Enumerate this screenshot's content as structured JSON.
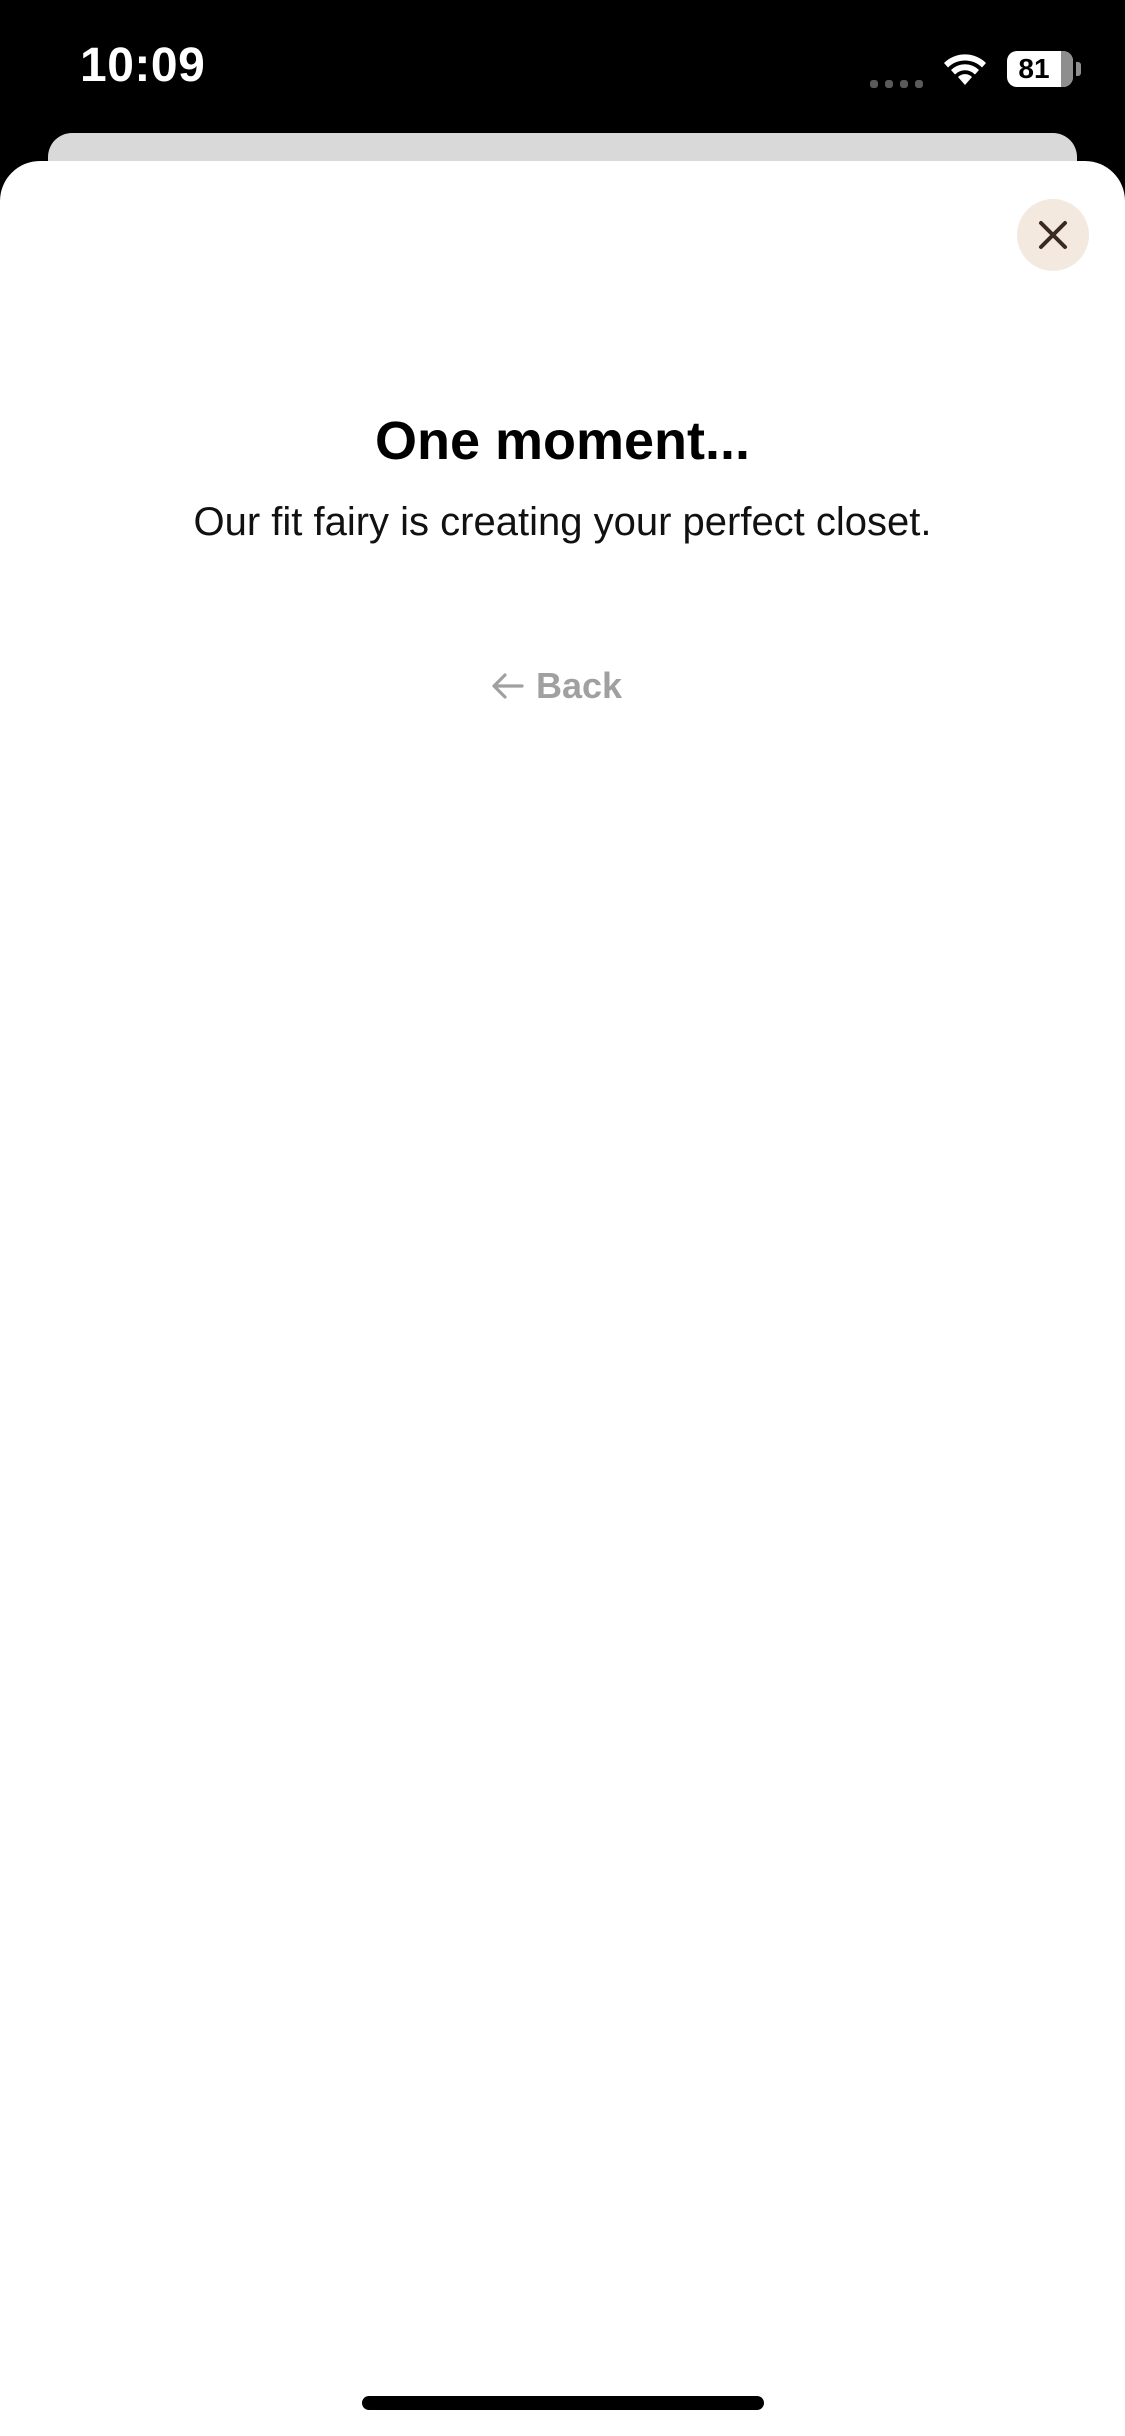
{
  "status_bar": {
    "time": "10:09",
    "battery_level": "81"
  },
  "loading": {
    "title": "One moment...",
    "subtitle": "Our fit fairy is creating your perfect closet."
  },
  "navigation": {
    "back_label": "Back"
  },
  "icons": {
    "close": "close-icon",
    "back": "arrow-left-icon",
    "wifi": "wifi-icon",
    "battery": "battery-icon"
  },
  "colors": {
    "close_button_bg": "#f3e9df",
    "close_icon": "#3a2a20",
    "back_text": "#a0a0a0"
  }
}
